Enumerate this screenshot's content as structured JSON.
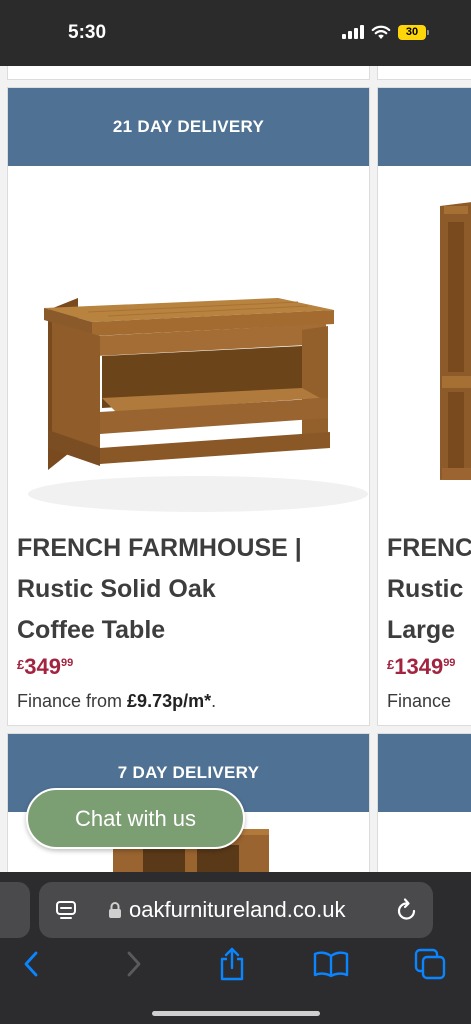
{
  "status_bar": {
    "time": "5:30",
    "battery_level": "30",
    "icons": [
      "cellular-signal-icon",
      "wifi-icon",
      "battery-icon"
    ]
  },
  "products": [
    {
      "delivery_badge": "21 DAY DELIVERY",
      "title_lines": [
        "FRENCH FARMHOUSE |",
        "Rustic Solid Oak",
        "Coffee Table"
      ],
      "price": {
        "currency": "£",
        "main": "349",
        "pence": "99"
      },
      "finance": {
        "prefix": "Finance from ",
        "amount": "£9.73p/m*",
        "suffix": "."
      }
    },
    {
      "delivery_badge": "",
      "title_lines": [
        "FRENC",
        "Rustic",
        "Large"
      ],
      "price": {
        "currency": "£",
        "main": "1349",
        "pence": "99"
      },
      "finance": {
        "prefix": "Finance",
        "amount": "",
        "suffix": ""
      }
    },
    {
      "delivery_badge": "7 DAY DELIVERY"
    },
    {
      "delivery_badge": ""
    }
  ],
  "chat": {
    "label": "Chat with us"
  },
  "browser": {
    "url": "oakfurnitureland.co.uk",
    "toolbar": [
      "back-icon",
      "forward-icon",
      "share-icon",
      "bookmarks-icon",
      "tabs-icon"
    ]
  },
  "colors": {
    "banner": "#4f7193",
    "price": "#a2243f",
    "chat_button": "#7c9e73",
    "browser_chrome": "#2c2c2e",
    "toolbar_accent": "#0a84ff"
  }
}
